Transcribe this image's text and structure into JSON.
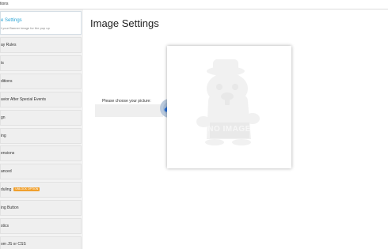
{
  "window": {
    "title": "tions"
  },
  "sidebar": {
    "active": {
      "label": "e Settings",
      "sub": "t your Banner image for the pop up"
    },
    "items": [
      {
        "label": "ay Rules"
      },
      {
        "label": "ts"
      },
      {
        "label": "ditions"
      },
      {
        "label": "avior After Special Events"
      },
      {
        "label": "gn"
      },
      {
        "label": "ing"
      },
      {
        "label": "ensions"
      },
      {
        "label": "anced"
      },
      {
        "label": "duling",
        "badge": "UNLOCK OPTION"
      },
      {
        "label": "ing Button"
      },
      {
        "label": "stics"
      },
      {
        "label": "om JS or CSS"
      }
    ]
  },
  "main": {
    "title": "Image Settings",
    "picture_label": "Please choose your picture:",
    "picture_value": "",
    "upload_icon": "cloud-upload-icon",
    "preview": {
      "text": "NO IMAGE",
      "icon": "beaver-placeholder-icon"
    }
  },
  "colors": {
    "accent": "#2aa4d6",
    "badge": "#f0a02e",
    "upload": "#2b6fd6"
  }
}
